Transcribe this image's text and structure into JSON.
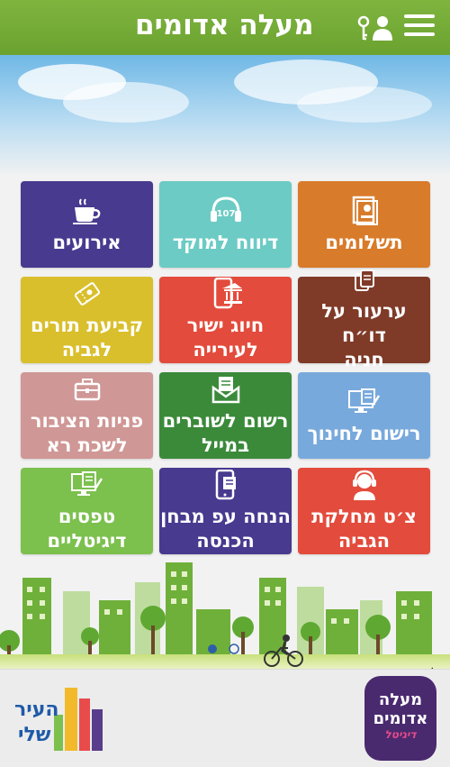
{
  "header": {
    "title": "מעלה אדומים",
    "menu_icon": "hamburger-menu-icon",
    "user_icon": "user-key-icon"
  },
  "tiles": [
    {
      "key": "payments",
      "label": "תשלומים",
      "color": "#d87b2a",
      "icon": "receipt-icon"
    },
    {
      "key": "report",
      "label": "דיווח למוקד",
      "color": "#6ccbc4",
      "icon": "headset-107-icon",
      "icon_text": "מוקד 107"
    },
    {
      "key": "events",
      "label": "אירועים",
      "color": "#473a8f",
      "icon": "coffee-cup-icon"
    },
    {
      "key": "appeal",
      "label": "ערעור על דו״ח\nחניה",
      "color": "#7f3b28",
      "icon": "clipboard-copy-icon"
    },
    {
      "key": "direct-debit",
      "label": "חיוג ישיר\nלעירייה",
      "color": "#e34b3c",
      "icon": "phone-bank-icon"
    },
    {
      "key": "queue",
      "label": "קביעת תורים\nלגביה",
      "color": "#d9bf2c",
      "icon": "ticket-icon"
    },
    {
      "key": "education",
      "label": "רישום לחינוך",
      "color": "#78a9dc",
      "icon": "computer-form-icon"
    },
    {
      "key": "mail-vouchers",
      "label": "רשום לשוברים\nבמייל",
      "color": "#3b8a3a",
      "icon": "envelope-doc-icon"
    },
    {
      "key": "public",
      "label": "פניות הציבור\nלשכת רא",
      "color": "#cf9795",
      "icon": "briefcase-icon"
    },
    {
      "key": "chat",
      "label": "צ׳ט מחלקת\nהגביה",
      "color": "#e34b3c",
      "icon": "support-agent-icon"
    },
    {
      "key": "exam",
      "label": "הנחה עפ מבחן\nהכנסה",
      "color": "#473a8f",
      "icon": "mobile-doc-icon"
    },
    {
      "key": "forms",
      "label": "טפסים\nדיגיטליים",
      "color": "#7cc04e",
      "icon": "monitor-form-icon"
    }
  ],
  "footer": {
    "logo_left_line1": "העיר",
    "logo_left_line2": "שלי",
    "logo_right_line1": "מעלה",
    "logo_right_line2": "אדומים",
    "logo_right_sub": "דיגיטל"
  },
  "colors": {
    "header_green": "#72a935",
    "sky_blue": "#6fb8e6",
    "city_green": "#7cbd3c",
    "footer_purple": "#4a2a6f"
  }
}
